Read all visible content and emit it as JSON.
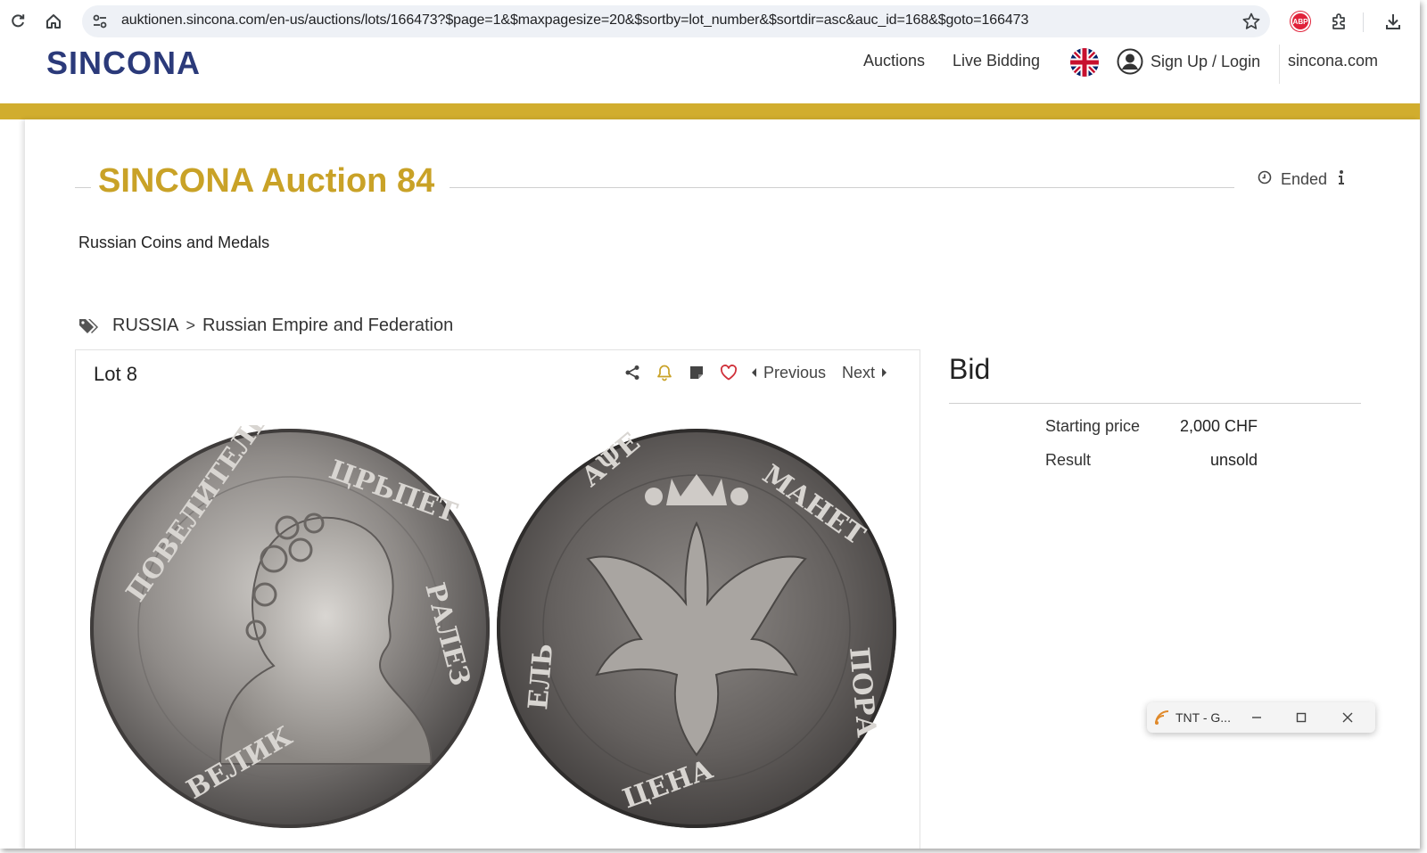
{
  "browser": {
    "url": "auktionen.sincona.com/en-us/auctions/lots/166473?$page=1&$maxpagesize=20&$sortby=lot_number&$sortdir=asc&auc_id=168&$goto=166473",
    "extension_abp_label": "ABP"
  },
  "header": {
    "logo": "SINCONA",
    "nav": {
      "auctions": "Auctions",
      "live_bidding": "Live Bidding",
      "signup_login": "Sign Up / Login",
      "external": "sincona.com"
    },
    "accent_color": "#d1ad2e",
    "brand_color": "#2b3a7a"
  },
  "auction": {
    "title": "SINCONA Auction 84",
    "status": "Ended",
    "subtitle": "Russian Coins and Medals"
  },
  "breadcrumb": {
    "level1": "RUSSIA",
    "separator": ">",
    "level2": "Russian Empire and Federation"
  },
  "lot": {
    "title": "Lot 8",
    "previous": "Previous",
    "next": "Next"
  },
  "bid": {
    "title": "Bid",
    "starting_price_label": "Starting price",
    "starting_price_value": "2,000 CHF",
    "result_label": "Result",
    "result_value": "unsold"
  },
  "mini_window": {
    "title": "TNT - G..."
  }
}
